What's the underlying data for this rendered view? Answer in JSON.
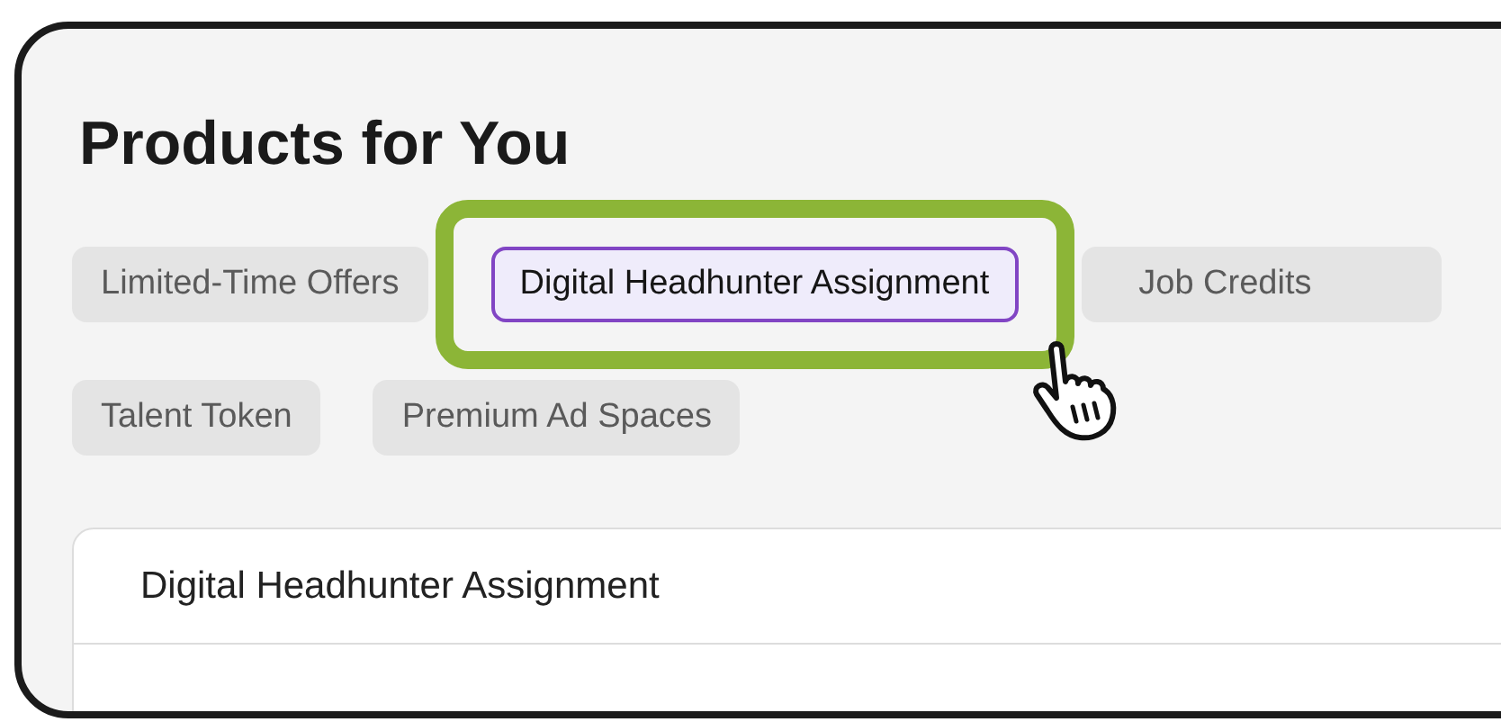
{
  "heading": "Products for You",
  "chips": [
    {
      "label": "Limited-Time Offers",
      "selected": false,
      "highlighted": false
    },
    {
      "label": "Digital Headhunter Assignment",
      "selected": true,
      "highlighted": true
    },
    {
      "label": "Job Credits",
      "selected": false,
      "highlighted": false
    },
    {
      "label": "Talent Token",
      "selected": false,
      "highlighted": false
    },
    {
      "label": "Premium Ad Spaces",
      "selected": false,
      "highlighted": false
    }
  ],
  "panel": {
    "title": "Digital Headhunter Assignment"
  }
}
